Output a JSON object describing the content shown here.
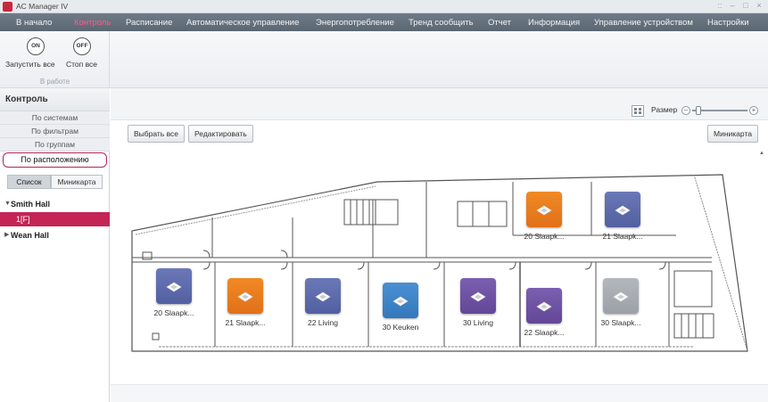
{
  "window": {
    "title": "AC Manager IV",
    "controls": [
      "::",
      "–",
      "□",
      "×"
    ]
  },
  "menu": {
    "items": [
      {
        "label": "В начало",
        "active": false
      },
      {
        "label": "Контроль",
        "active": true
      },
      {
        "label": "Расписание",
        "active": false
      },
      {
        "label": "Автоматическое управление",
        "active": false
      },
      {
        "label": "Энергопотребление",
        "active": false
      },
      {
        "label": "Тренд сообщить",
        "active": false
      },
      {
        "label": "Отчет",
        "active": false
      },
      {
        "label": "Информация",
        "active": false
      },
      {
        "label": "Управление устройством",
        "active": false
      },
      {
        "label": "Настройки",
        "active": false
      }
    ]
  },
  "toolbar": {
    "on_icon": "ON",
    "off_icon": "OFF",
    "start_all": "Запустить все",
    "stop_all": "Стоп все",
    "group_label": "В работе"
  },
  "sidebar": {
    "header": "Контроль",
    "views": [
      "По системам",
      "По фильтрам",
      "По группам",
      "По расположению"
    ],
    "selected_view": "По расположению",
    "tabs": [
      "Список",
      "Миникарта"
    ],
    "tree": [
      {
        "label": "Smith Hall",
        "expanded": true
      },
      {
        "label": "1[F]",
        "selected": true
      },
      {
        "label": "Wean Hall",
        "expanded": false
      }
    ]
  },
  "main": {
    "size_label": "Размер",
    "size_level": 0.1,
    "select_all": "Выбрать все",
    "edit": "Редактировать",
    "minimap": "Миникарта"
  },
  "units": [
    {
      "label": "20 Slaapk...",
      "color": "#f08a24",
      "color2": "#e1701a"
    },
    {
      "label": "21 Slaapk...",
      "color": "#6b78b8",
      "color2": "#525fa0"
    },
    {
      "label": "20 Slaapk...",
      "color": "#6b78b8",
      "color2": "#525fa0"
    },
    {
      "label": "21 Slaapk...",
      "color": "#f08a24",
      "color2": "#e1701a"
    },
    {
      "label": "22 Living",
      "color": "#6b78b8",
      "color2": "#525fa0"
    },
    {
      "label": "30 Keuken",
      "color": "#4a90d2",
      "color2": "#3478bc"
    },
    {
      "label": "30 Living",
      "color": "#7b5fb0",
      "color2": "#634796"
    },
    {
      "label": "22 Slaapk...",
      "color": "#7b5fb0",
      "color2": "#634796"
    },
    {
      "label": "30 Slaapk...",
      "color": "#b4b8bd",
      "color2": "#9ca1a7"
    }
  ],
  "colors": {
    "accent": "#c32556",
    "menu_active": "#ff5a8a",
    "menubar": "#66727e"
  }
}
